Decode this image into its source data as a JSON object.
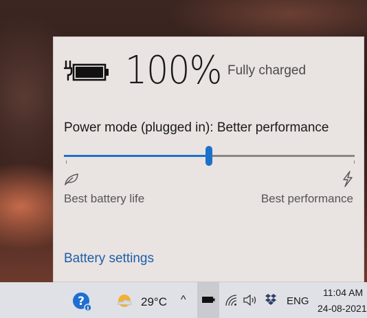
{
  "battery": {
    "percent_text": "100%",
    "status": "Fully charged",
    "level_fraction": 1.0
  },
  "power_mode": {
    "label": "Power mode (plugged in): Better performance",
    "slider_position_fraction": 0.5,
    "left_label": "Best battery life",
    "right_label": "Best performance",
    "left_icon": "leaf-icon",
    "right_icon": "lightning-bolt-icon"
  },
  "settings_link": "Battery settings",
  "taskbar": {
    "temperature": "29°C",
    "language": "ENG",
    "time": "11:04 AM",
    "date": "24-08-2021",
    "icons": [
      "help-icon",
      "weather-icon",
      "chevron-up-icon",
      "battery-icon",
      "wifi-icon",
      "volume-icon",
      "dropbox-icon"
    ]
  },
  "colors": {
    "accent": "#1b71c9",
    "link": "#1c5ea8",
    "flyout_bg": "#e9e3e1",
    "taskbar_bg": "#dfe1e6"
  }
}
